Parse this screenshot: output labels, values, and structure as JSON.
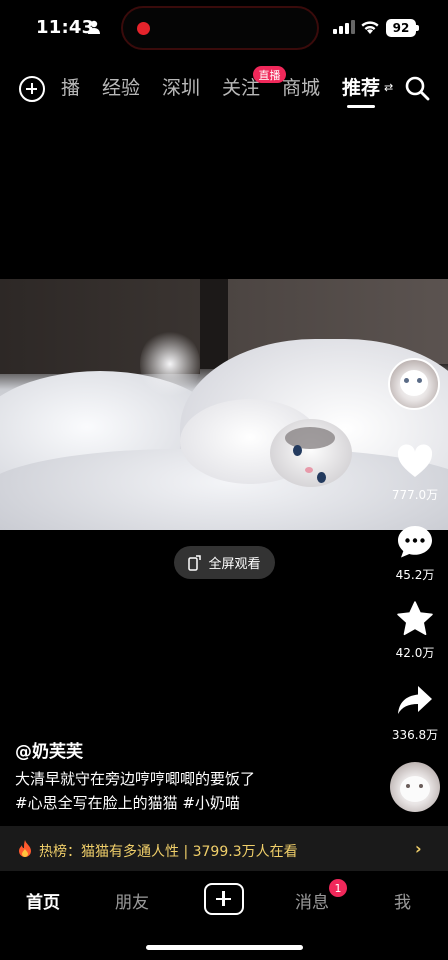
{
  "status_bar": {
    "time": "11:43",
    "battery": "92",
    "recording_color": "#e5232b"
  },
  "top_nav": {
    "tabs": [
      "播",
      "经验",
      "深圳",
      "关注",
      "商城",
      "推荐"
    ],
    "active_tab": "推荐",
    "live_badge": "直播",
    "switch_glyph": "⇄"
  },
  "video": {
    "fullscreen_label": "全屏观看"
  },
  "side_actions": {
    "likes": "777.0万",
    "comments": "45.2万",
    "favorites": "42.0万",
    "shares": "336.8万"
  },
  "caption": {
    "author": "@奶芙芙",
    "line1": "大清早就守在旁边哼哼唧唧的要饭了",
    "line2": "#心思全写在脸上的猫猫 #小奶喵"
  },
  "hot_bar": {
    "text": "热榜：猫猫有多通人性 | 3799.3万人在看",
    "arrow": "›"
  },
  "bottom_nav": {
    "home": "首页",
    "friends": "朋友",
    "messages": "消息",
    "message_badge": "1",
    "me": "我"
  },
  "colors": {
    "accent": "#f0285a",
    "hot_text": "#f0cf6a"
  }
}
